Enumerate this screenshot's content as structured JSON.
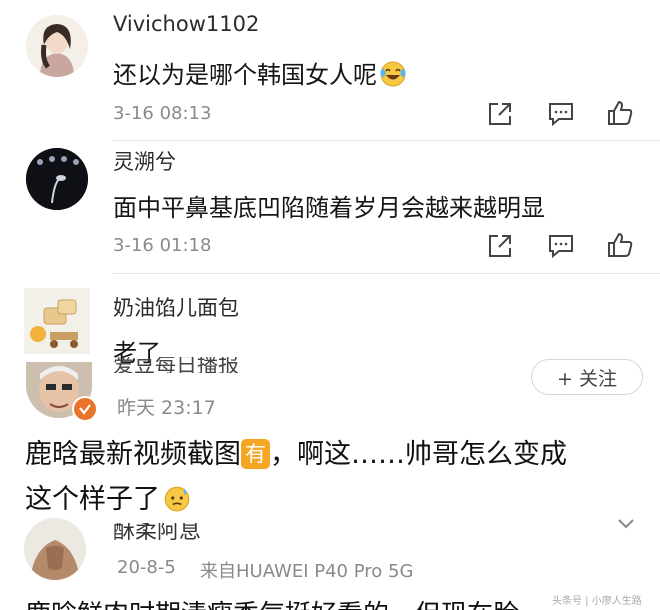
{
  "comments": [
    {
      "username": "Vivichow1102",
      "text": "还以为是哪个韩国女人呢",
      "time": "3-16 08:13",
      "emoji": "laughing-tears-emoji"
    },
    {
      "username": "灵溯兮",
      "text": "面中平鼻基底凹陷随着岁月会越来越明显",
      "time": "3-16 01:18"
    },
    {
      "username": "奶油馅儿面包",
      "text": "老了"
    }
  ],
  "post": {
    "author_partial": "爱豆每日播报",
    "time": "昨天 23:17",
    "follow_label": "+ 关注",
    "badge": "verified-badge",
    "text_line1_a": "鹿晗最新视频截图",
    "text_tag": "有",
    "text_line1_b": "，啊这……帅哥怎么变成",
    "text_line2": "这个样子了"
  },
  "post2": {
    "author_partial": "酥柔阿息",
    "time": "20-8-5",
    "source": "来自HUAWEI P40 Pro 5G",
    "text_partial": "鹿晗鲜肉时期清瘦秀气挺好看的，但现在脸"
  },
  "watermark": "头条号 | 小廖人生路",
  "icons": [
    "share-icon",
    "comment-icon",
    "like-icon",
    "chevron-down-icon"
  ],
  "colors": {
    "follow_border": "#d6d6d6",
    "follow_text": "#444444",
    "badge": "#e8742a",
    "tag_bg": "#f5a623"
  }
}
